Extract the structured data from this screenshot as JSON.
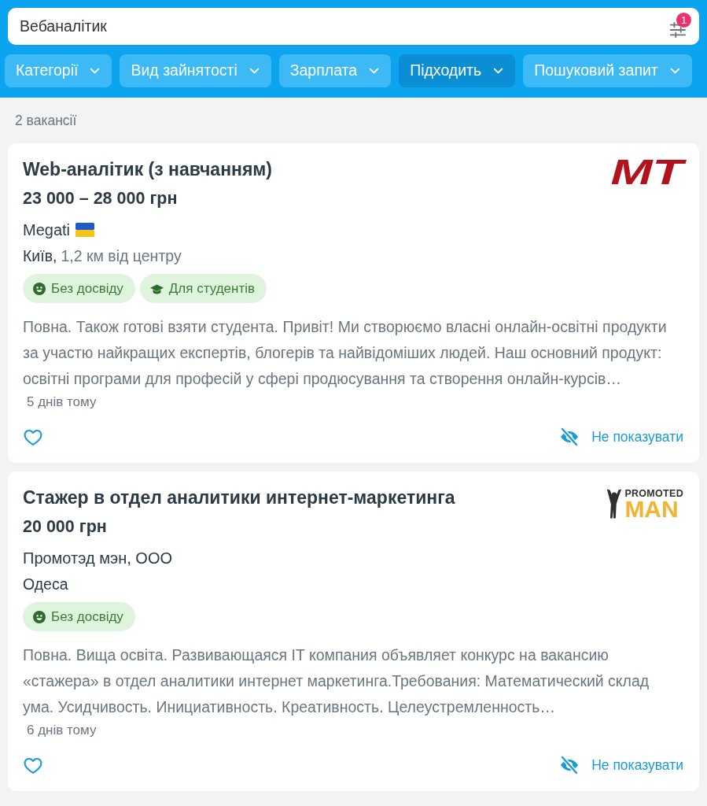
{
  "search": {
    "value": "Вебаналітик",
    "filter_badge": "1"
  },
  "filters": [
    {
      "label": "Категорії",
      "selected": false
    },
    {
      "label": "Вид зайнятості",
      "selected": false
    },
    {
      "label": "Зарплата",
      "selected": false
    },
    {
      "label": "Підходить",
      "selected": true
    },
    {
      "label": "Пошуковий запит",
      "selected": false
    }
  ],
  "results_count": "2 вакансії",
  "vacancies": [
    {
      "title": "Web-аналітик (з навчанням)",
      "salary": "23 000 – 28 000 грн",
      "logo": {
        "kind": "mt",
        "lines": [
          "MT"
        ]
      },
      "company": "Megati",
      "flag": true,
      "city": "Київ,",
      "distance": "1,2 км від центру",
      "tags": [
        {
          "kind": "experience",
          "label": "Без досвіду"
        },
        {
          "kind": "students",
          "label": "Для студентів"
        }
      ],
      "description": "Повна. Також готові взяти студента. Привіт! Ми створюємо власні онлайн-освітні продукти за участю найкращих експертів, блогерів та найвідоміших людей. Наш основний продукт: освітні програми для професій у сфері продюсування та створення онлайн-курсів…",
      "posted": "5 днів тому",
      "favorite": false,
      "hide_label": "Не показувати"
    },
    {
      "title": "Стажер в отдел аналитики интернет-маркетинга",
      "salary": "20 000 грн",
      "logo": {
        "kind": "promoted",
        "lines": [
          "PROMOTED",
          "MAN"
        ]
      },
      "company": "Промотэд мэн, ООО",
      "flag": false,
      "city": "Одеса",
      "tags": [
        {
          "kind": "experience",
          "label": "Без досвіду"
        }
      ],
      "description": "Повна. Вища освіта. Развивающаяся IT компания объявляет конкурс на вакансию «стажера» в отдел аналитики интернет маркетинга.Требования: Математический склад ума. Усидчивость. Инициативность. Креативность. Целеустремленность…",
      "posted": "6 днів тому",
      "favorite": false,
      "hide_label": "Не показувати"
    }
  ]
}
